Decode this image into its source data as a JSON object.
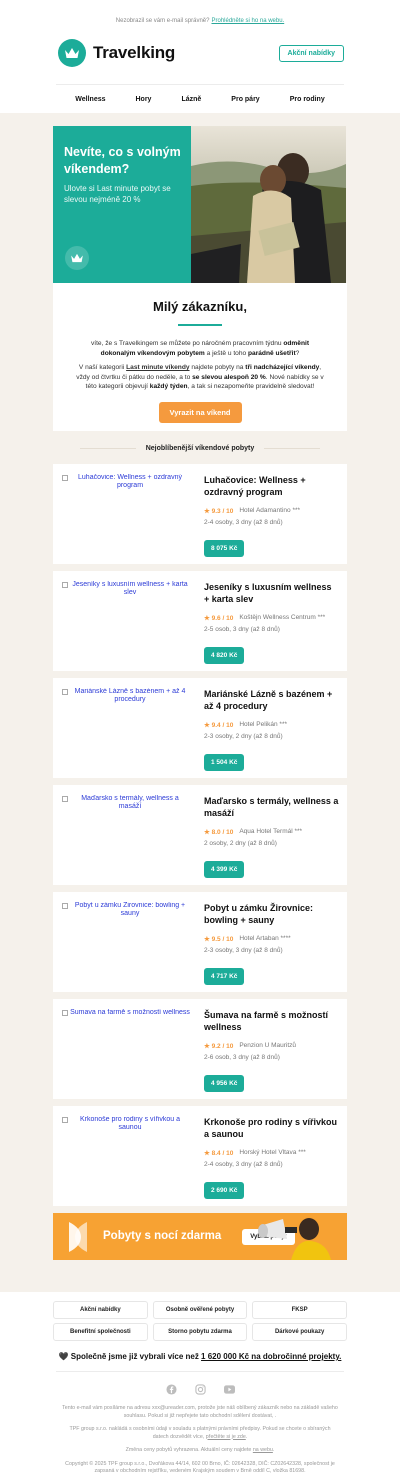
{
  "preheader": {
    "text": "Nezobrazil se vám e-mail správně?",
    "link": "Prohlédněte si ho na webu."
  },
  "header": {
    "brand": "Travelking",
    "cta": "Akční nabídky"
  },
  "nav": [
    "Wellness",
    "Hory",
    "Lázně",
    "Pro páry",
    "Pro rodiny"
  ],
  "hero": {
    "title": "Nevíte, co s volným víkendem?",
    "subtitle": "Ulovte si Last minute pobyt se slevou nejméně 20 %"
  },
  "intro": {
    "greeting": "Milý zákazníku,",
    "p1a": "víte, že s Travelkingem se můžete po náročném pracovním týdnu ",
    "p1b": "odměnit dokonalým víkendovým pobytem",
    "p1c": " a ještě u toho ",
    "p1d": "parádně ušetřit",
    "p1e": "?",
    "p2a": "V naší kategorii ",
    "p2b": "Last minute víkendy",
    "p2c": " najdete pobyty na ",
    "p2d": "tři nadcházející víkendy",
    "p2e": ", vždy od čtvrtku či pátku do neděle, a to ",
    "p2f": "se slevou alespoň 20 %",
    "p2g": ". Nové nabídky se v této kategorii objevují ",
    "p2h": "každý týden",
    "p2i": ", a tak si nezapomeňte pravidelně sledovat!",
    "button": "Vyrazit na víkend"
  },
  "section_title": "Nejoblíbenější víkendové pobyty",
  "offers": [
    {
      "alt": "Luhačovice: Wellness + ozdravný program",
      "title": "Luhačovice: Wellness + ozdravný program",
      "rating": "★ 9.3 / 10",
      "hotel": "Hotel Adamantino ***",
      "details": "2-4 osoby, 3 dny (až 8 dnů)",
      "price": "8 075 Kč"
    },
    {
      "alt": "Jeseníky s luxusním wellness + karta slev",
      "title": "Jeseníky s luxusním wellness + karta slev",
      "rating": "★ 9.6 / 10",
      "hotel": "Koštějn Wellness Centrum ***",
      "details": "2-5 osob, 3 dny (až 8 dnů)",
      "price": "4 820 Kč"
    },
    {
      "alt": "Mariánské Lázně s bazénem + až 4 procedury",
      "title": "Mariánské Lázně s bazénem + až 4 procedury",
      "rating": "★ 9.4 / 10",
      "hotel": "Hotel Pelikán ***",
      "details": "2-3 osoby, 2 dny (až 8 dnů)",
      "price": "1 504 Kč"
    },
    {
      "alt": "Maďarsko s termály, wellness a masáží",
      "title": "Maďarsko s termály, wellness a masáží",
      "rating": "★ 8.0 / 10",
      "hotel": "Aqua Hotel Termál ***",
      "details": "2 osoby, 2 dny (až 8 dnů)",
      "price": "4 399 Kč"
    },
    {
      "alt": "Pobyt u zámku Žirovnice: bowling + sauny",
      "title": "Pobyt u zámku Žirovnice: bowling + sauny",
      "rating": "★ 9.5 / 10",
      "hotel": "Hotel Artaban ****",
      "details": "2-3 osoby, 3 dny (až 8 dnů)",
      "price": "4 717 Kč"
    },
    {
      "alt": "Šumava na farmě s možností wellness",
      "title": "Šumava na farmě s možností wellness",
      "rating": "★ 9.2 / 10",
      "hotel": "Penzion U Mauritzů",
      "details": "2-6 osob, 3 dny (až 8 dnů)",
      "price": "4 956 Kč"
    },
    {
      "alt": "Krkonoše pro rodiny s vířivkou a saunou",
      "title": "Krkonoše pro rodiny s vířivkou a saunou",
      "rating": "★ 8.4 / 10",
      "hotel": "Horský Hotel Vltava ***",
      "details": "2-4 osoby, 3 dny (až 8 dnů)",
      "price": "2 690 Kč"
    }
  ],
  "promo": {
    "title": "Pobyty s nocí zdarma",
    "button": "Vybrat pobyt"
  },
  "footer": {
    "links": [
      "Akční nabídky",
      "Osobně ověřené pobyty",
      "FKSP",
      "Benefitní společnosti",
      "Storno pobytu zdarma",
      "Dárkové poukazy"
    ],
    "charity_a": "🖤 Společně jsme již vybrali více než ",
    "charity_b": "1 620 000 Kč na dobročinné projekty.",
    "legal1": "Tento e-mail vám posíláme na adresu xxx@ureader.com, protože jste náš oblíbený zákazník nebo na základě vašeho souhlasu. Pokud si již nepřejete tato obchodní sdělení dostávat, .",
    "legal2a": "TPF group s.r.o. nakládá s osobními údaji v souladu s platnými právními předpisy. Pokud se chcete o sbíraných datech dozvědět více, ",
    "legal2b": "přečtěte si je zde",
    "legal2c": ".",
    "legal3a": "Změna ceny pobytů vyhrazena. Aktuální ceny najdete ",
    "legal3b": "na webu",
    "legal3c": ".",
    "legal4": "Copyright © 2025 TPF group s.r.o., Dvořákova 44/14, 602 00 Brno, IČ: 02642328, DIČ: CZ02642328, společnost je zapsaná v obchodním rejstříku, vedeném Krajským soudem v Brně oddíl C, vložka 81698."
  },
  "colors": {
    "brand": "#1cac99",
    "accent": "#f59a3e",
    "background": "#f5f1eb"
  }
}
